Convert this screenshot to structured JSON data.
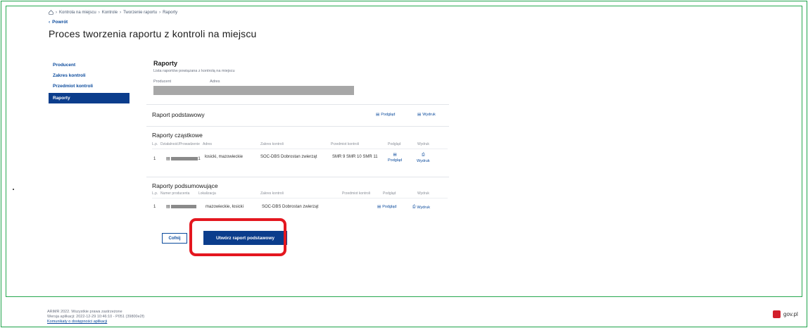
{
  "breadcrumb": [
    "Kontrola na miejscu",
    "Kontrole",
    "Tworzenie raportu",
    "Raporty"
  ],
  "back_label": "Powrót",
  "page_title": "Proces tworzenia raportu z kontroli na miejscu",
  "sidenav": {
    "items": [
      {
        "label": "Producent",
        "active": false
      },
      {
        "label": "Zakres kontroli",
        "active": false
      },
      {
        "label": "Przedmiot kontroli",
        "active": false
      },
      {
        "label": "Raporty",
        "active": true
      }
    ]
  },
  "raporty": {
    "title": "Raporty",
    "subtitle": "Lista raportów powiązana z kontrolą na miejscu",
    "col_producent": "Producent",
    "col_adres": "Adres"
  },
  "raport_podstawowy": {
    "title": "Raport podstawowy",
    "preview": "Podgląd",
    "print": "Wydruk"
  },
  "raporty_czastkowe": {
    "title": "Raporty cząstkowe",
    "headers": [
      "L.p.",
      "Działalność/Prowadzenie",
      "Adres",
      "Zakres kontroli",
      "Przedmiot kontroli",
      "Podgląd",
      "Wydruk"
    ],
    "rows": [
      {
        "lp": "1",
        "id_suffix": "1",
        "adres": "łosicki, mazowieckie",
        "zakres": "SOC-DBS Dobrostan zwierząt",
        "przedmiot": "SMR 9 SMR 10 SMR 11",
        "preview": "Podgląd",
        "print": "Wydruk"
      }
    ]
  },
  "raporty_podsumowujace": {
    "title": "Raporty podsumowujące",
    "headers": [
      "L.p.",
      "Numer producenta",
      "Lokalizacja",
      "Zakres kontroli",
      "Przedmiot kontroli",
      "Podgląd",
      "Wydruk"
    ],
    "rows": [
      {
        "lp": "1",
        "lokalizacja": "mazowieckie, łosicki",
        "zakres": "SOC-DBS Dobrostan zwierząt",
        "preview": "Podgląd",
        "print": "Wydruk"
      }
    ]
  },
  "buttons": {
    "cofnij": "Cofnij",
    "utworz": "Utwórz raport podstawowy"
  },
  "footer": {
    "line1": "ARiMR 2022. Wszystkie prawa zastrzeżone",
    "line2": "Wersja aplikacji: 2022-12-29 10:46:10 - P051 (39800e2f)",
    "link": "Komunikaty o dostępności aplikacji"
  },
  "gov_logo": "gov.pl",
  "colors": {
    "primary": "#0b3d8c",
    "highlight": "#e4171f",
    "frame": "#26a84f"
  }
}
